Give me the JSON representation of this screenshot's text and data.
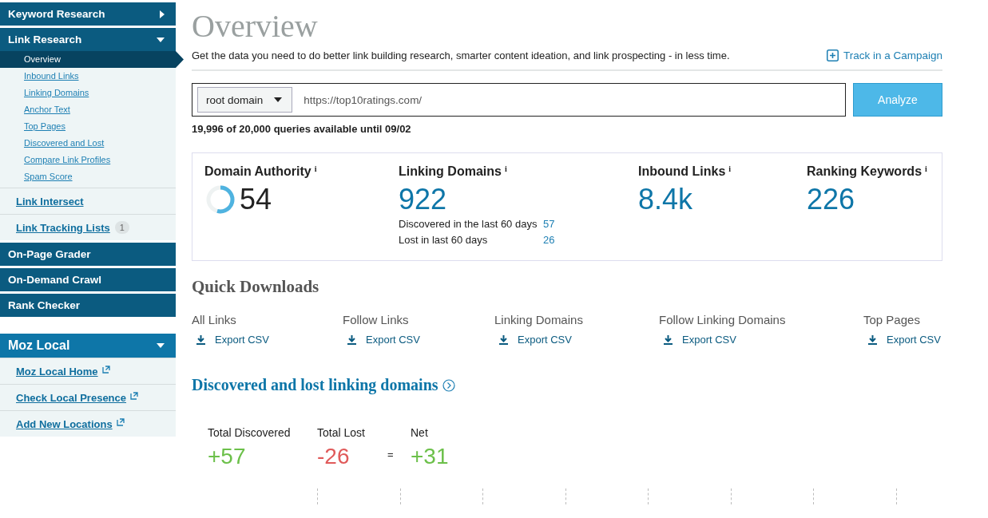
{
  "sidebar": {
    "items": [
      {
        "kind": "section",
        "label": "Keyword Research",
        "expanded": false
      },
      {
        "kind": "section",
        "label": "Link Research",
        "expanded": true,
        "children": [
          {
            "label": "Overview",
            "selected": true
          },
          {
            "label": "Inbound Links",
            "selected": false
          },
          {
            "label": "Linking Domains",
            "selected": false
          },
          {
            "label": "Anchor Text",
            "selected": false
          },
          {
            "label": "Top Pages",
            "selected": false
          },
          {
            "label": "Discovered and Lost",
            "selected": false
          },
          {
            "label": "Compare Link Profiles",
            "selected": false
          },
          {
            "label": "Spam Score",
            "selected": false
          }
        ]
      },
      {
        "kind": "link",
        "label": "Link Intersect"
      },
      {
        "kind": "link",
        "label": "Link Tracking Lists",
        "badge": "1"
      },
      {
        "kind": "plain",
        "label": "On-Page Grader"
      },
      {
        "kind": "plain",
        "label": "On-Demand Crawl"
      },
      {
        "kind": "plain",
        "label": "Rank Checker"
      },
      {
        "kind": "local",
        "label": "Moz Local",
        "expanded": true
      },
      {
        "kind": "external",
        "label": "Moz Local Home"
      },
      {
        "kind": "external",
        "label": "Check Local Presence"
      },
      {
        "kind": "external",
        "label": "Add New Locations"
      }
    ]
  },
  "page": {
    "title": "Overview",
    "subtitle": "Get the data you need to do better link building research, smarter content ideation, and link prospecting - in less time.",
    "track_link": "Track in a Campaign"
  },
  "search": {
    "scope": "root domain",
    "value": "https://top10ratings.com/",
    "button": "Analyze",
    "quota": "19,996 of 20,000 queries available until 09/02"
  },
  "metrics": [
    {
      "kind": "ring",
      "label": "Domain Authority",
      "info": "i",
      "value": "54",
      "level": 0.54
    },
    {
      "kind": "detail",
      "label": "Linking Domains",
      "info": "i",
      "value": "922",
      "details": [
        {
          "label": "Discovered in the last 60 days",
          "value": "57"
        },
        {
          "label": "Lost in last 60 days",
          "value": "26"
        }
      ]
    },
    {
      "kind": "plain",
      "label": "Inbound Links",
      "info": "i",
      "value": "8.4k"
    },
    {
      "kind": "plain",
      "label": "Ranking Keywords",
      "info": "i",
      "value": "226"
    }
  ],
  "quick_downloads": {
    "title": "Quick Downloads",
    "items": [
      {
        "label": "All Links",
        "action": "Export CSV"
      },
      {
        "label": "Follow Links",
        "action": "Export CSV"
      },
      {
        "label": "Linking Domains",
        "action": "Export CSV"
      },
      {
        "label": "Follow Linking Domains",
        "action": "Export CSV"
      },
      {
        "label": "Top Pages",
        "action": "Export CSV"
      }
    ]
  },
  "discovered": {
    "title": "Discovered and lost linking domains",
    "totals": [
      {
        "kind": "gain",
        "label": "Total Discovered",
        "value": "+57"
      },
      {
        "kind": "loss",
        "label": "Total Lost",
        "value": "-26"
      },
      {
        "kind": "equals",
        "label": "="
      },
      {
        "kind": "gain",
        "label": "Net",
        "value": "+31"
      }
    ]
  }
}
